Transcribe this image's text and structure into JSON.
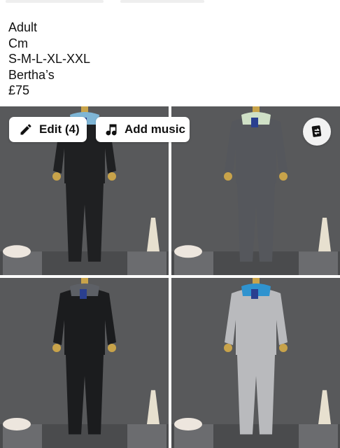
{
  "post": {
    "lines": [
      "Adult",
      "Cm",
      "S-M-L-XL-XXL",
      "Bertha’s",
      "£75"
    ]
  },
  "photo_actions": {
    "edit_label": "Edit (4)",
    "music_label": "Add music",
    "edit_icon": "pencil-icon",
    "music_icon": "music-note-icon",
    "swap_icon": "swap-photos-icon"
  },
  "photos": [
    {
      "name": "tracksuit-black-blue-collar",
      "suit_color": "#1f2022",
      "collar_color": "#7fb6d6"
    },
    {
      "name": "tracksuit-grey-mint-collar",
      "suit_color": "#55575c",
      "collar_color": "#cfe0c6"
    },
    {
      "name": "tracksuit-black-grey-panel",
      "suit_color": "#1b1c1e",
      "collar_color": "#5d6066"
    },
    {
      "name": "tracksuit-light-grey-blue",
      "suit_color": "#b9babd",
      "collar_color": "#2f93cf"
    }
  ]
}
